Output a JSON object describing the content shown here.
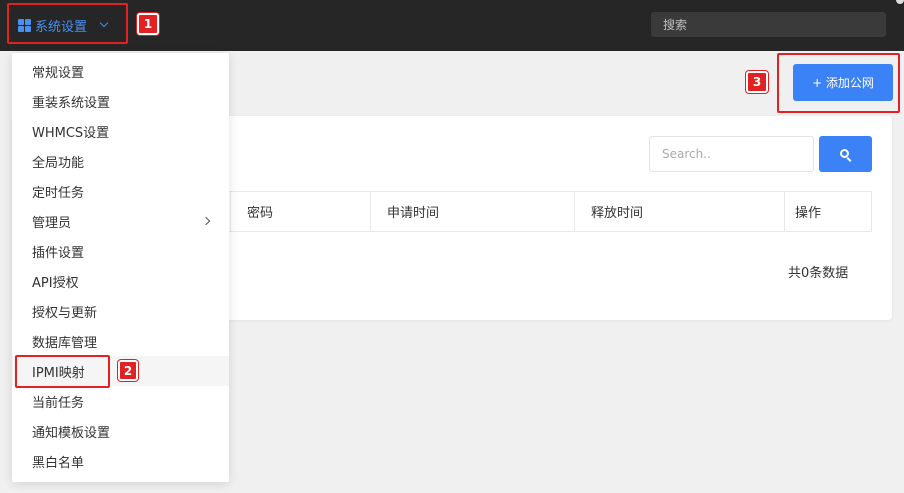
{
  "topbar": {
    "menu_label": "系统设置",
    "search_placeholder": "搜索"
  },
  "dropdown": {
    "items": [
      {
        "label": "常规设置"
      },
      {
        "label": "重装系统设置"
      },
      {
        "label": "WHMCS设置"
      },
      {
        "label": "全局功能"
      },
      {
        "label": "定时任务"
      },
      {
        "label": "管理员",
        "has_submenu": true
      },
      {
        "label": "插件设置"
      },
      {
        "label": "API授权"
      },
      {
        "label": "授权与更新"
      },
      {
        "label": "数据库管理"
      },
      {
        "label": "IPMI映射",
        "active": true
      },
      {
        "label": "当前任务"
      },
      {
        "label": "通知模板设置"
      },
      {
        "label": "黑白名单"
      }
    ]
  },
  "toolbar": {
    "add_label": "+ 添加公网"
  },
  "card": {
    "search_placeholder": "Search..",
    "columns": [
      "密码",
      "申请时间",
      "释放时间",
      "操作"
    ],
    "total_text": "共0条数据"
  },
  "annotations": {
    "badge_1": "1",
    "badge_2": "2",
    "badge_3": "3"
  },
  "colors": {
    "topbar_bg": "#262626",
    "accent": "#3b82f6",
    "highlight": "#e02222"
  }
}
